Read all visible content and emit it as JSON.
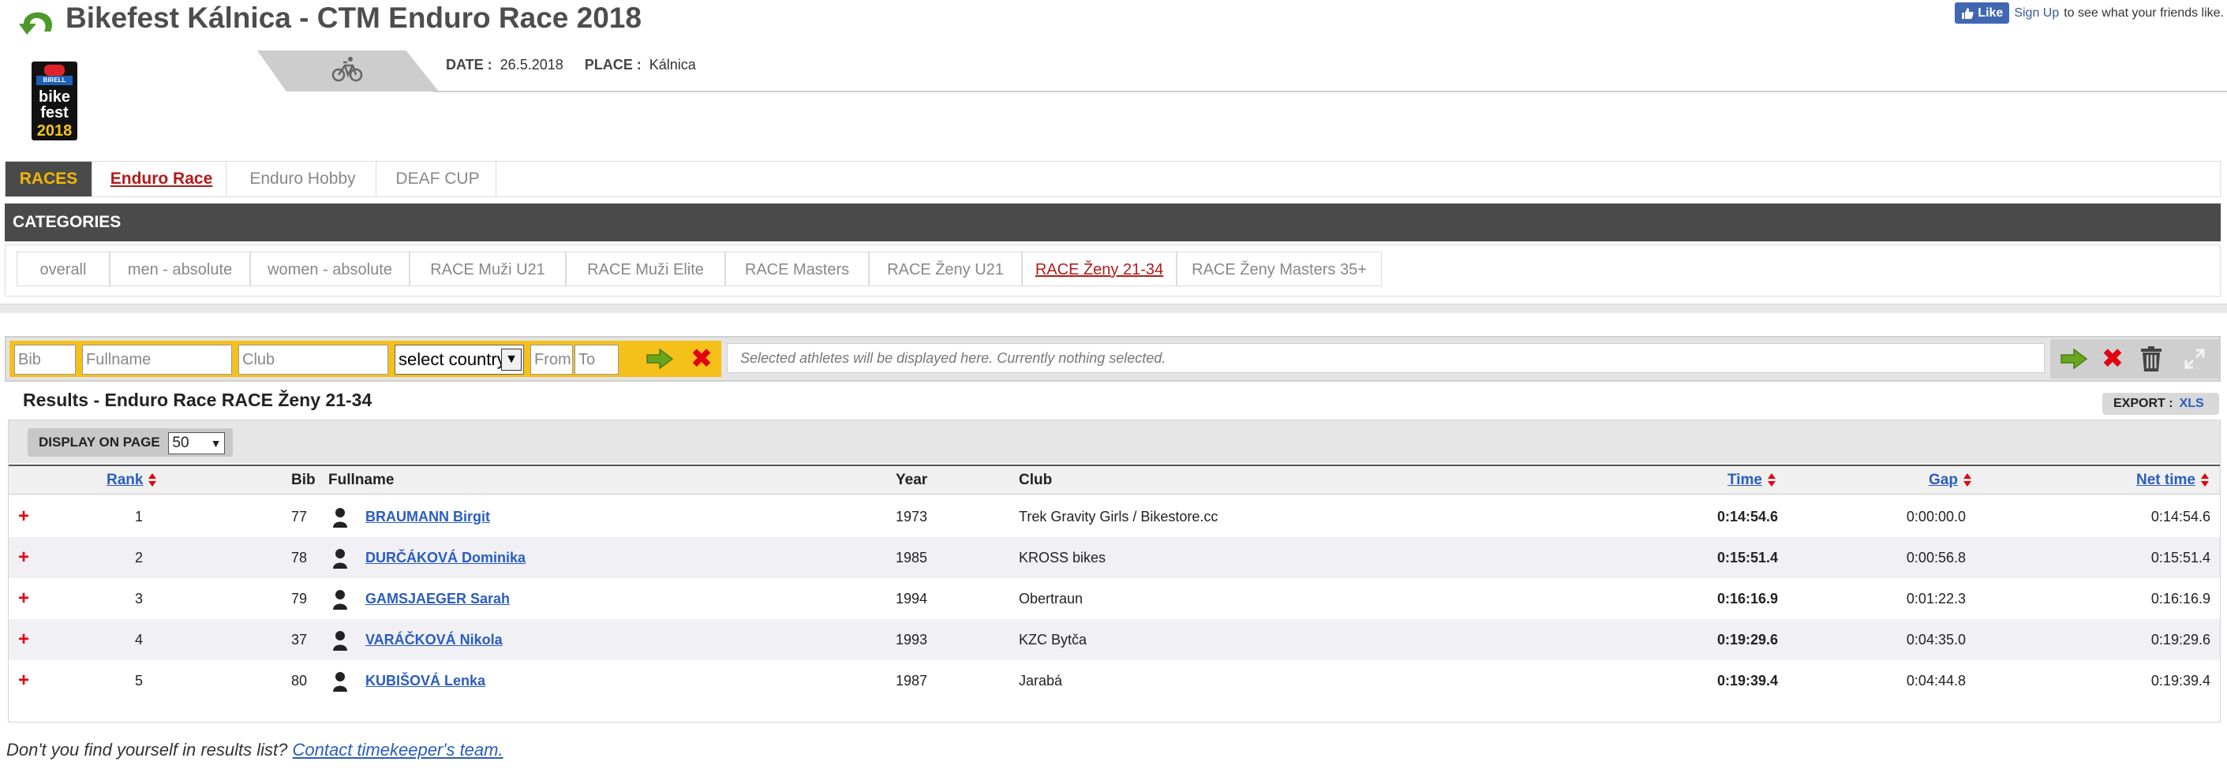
{
  "header": {
    "title": "Bikefest Kálnica - CTM Enduro Race 2018",
    "fb_like": "Like",
    "fb_signup": "Sign Up",
    "fb_text": "to see what your friends like."
  },
  "logo": {
    "badge": "BIRELL",
    "line1": "bike",
    "line2": "fest",
    "year": "2018"
  },
  "event": {
    "date_label": "DATE :",
    "date": "26.5.2018",
    "place_label": "PLACE :",
    "place": "Kálnica"
  },
  "races": {
    "label": "RACES",
    "tabs": [
      "Enduro Race",
      "Enduro Hobby",
      "DEAF CUP"
    ],
    "active": "Enduro Race"
  },
  "categories": {
    "label": "CATEGORIES",
    "items": [
      "overall",
      "men - absolute",
      "women - absolute",
      "RACE Muži U21",
      "RACE Muži Elite",
      "RACE Masters",
      "RACE Ženy U21",
      "RACE Ženy 21-34",
      "RACE Ženy Masters 35+"
    ],
    "active": "RACE Ženy 21-34"
  },
  "filter": {
    "bib_placeholder": "Bib",
    "fullname_placeholder": "Fullname",
    "club_placeholder": "Club",
    "country_select": "select country",
    "from_placeholder": "From",
    "to_placeholder": "To",
    "selected_text": "Selected athletes will be displayed here. Currently nothing selected."
  },
  "results": {
    "title": "Results - Enduro Race RACE Ženy 21-34",
    "export_label": "EXPORT :",
    "export_xls": "XLS",
    "display_label": "DISPLAY ON PAGE",
    "display_value": "50",
    "columns": {
      "rank": "Rank",
      "bib": "Bib",
      "fullname": "Fullname",
      "year": "Year",
      "club": "Club",
      "time": "Time",
      "gap": "Gap",
      "net_time": "Net time"
    },
    "rows": [
      {
        "rank": "1",
        "bib": "77",
        "name": "BRAUMANN Birgit",
        "year": "1973",
        "club": "Trek Gravity Girls / Bikestore.cc",
        "time": "0:14:54.6",
        "gap": "0:00:00.0",
        "net": "0:14:54.6"
      },
      {
        "rank": "2",
        "bib": "78",
        "name": "DURČÁKOVÁ Dominika",
        "year": "1985",
        "club": "KROSS bikes",
        "time": "0:15:51.4",
        "gap": "0:00:56.8",
        "net": "0:15:51.4"
      },
      {
        "rank": "3",
        "bib": "79",
        "name": "GAMSJAEGER Sarah",
        "year": "1994",
        "club": "Obertraun",
        "time": "0:16:16.9",
        "gap": "0:01:22.3",
        "net": "0:16:16.9"
      },
      {
        "rank": "4",
        "bib": "37",
        "name": "VARÁČKOVÁ Nikola",
        "year": "1993",
        "club": "KZC Bytča",
        "time": "0:19:29.6",
        "gap": "0:04:35.0",
        "net": "0:19:29.6"
      },
      {
        "rank": "5",
        "bib": "80",
        "name": "KUBIŠOVÁ Lenka",
        "year": "1987",
        "club": "Jarabá",
        "time": "0:19:39.4",
        "gap": "0:04:44.8",
        "net": "0:19:39.4"
      }
    ]
  },
  "footer": {
    "text": "Don't you find yourself in results list?",
    "link": "Contact timekeeper's team."
  },
  "colors": {
    "accent_yellow": "#f6c01b",
    "link_blue": "#2a5dbf",
    "active_red": "#b31b1b",
    "dark_bar": "#4a4a4a",
    "icon_red": "#e3000f",
    "icon_green": "#6aa51e"
  }
}
